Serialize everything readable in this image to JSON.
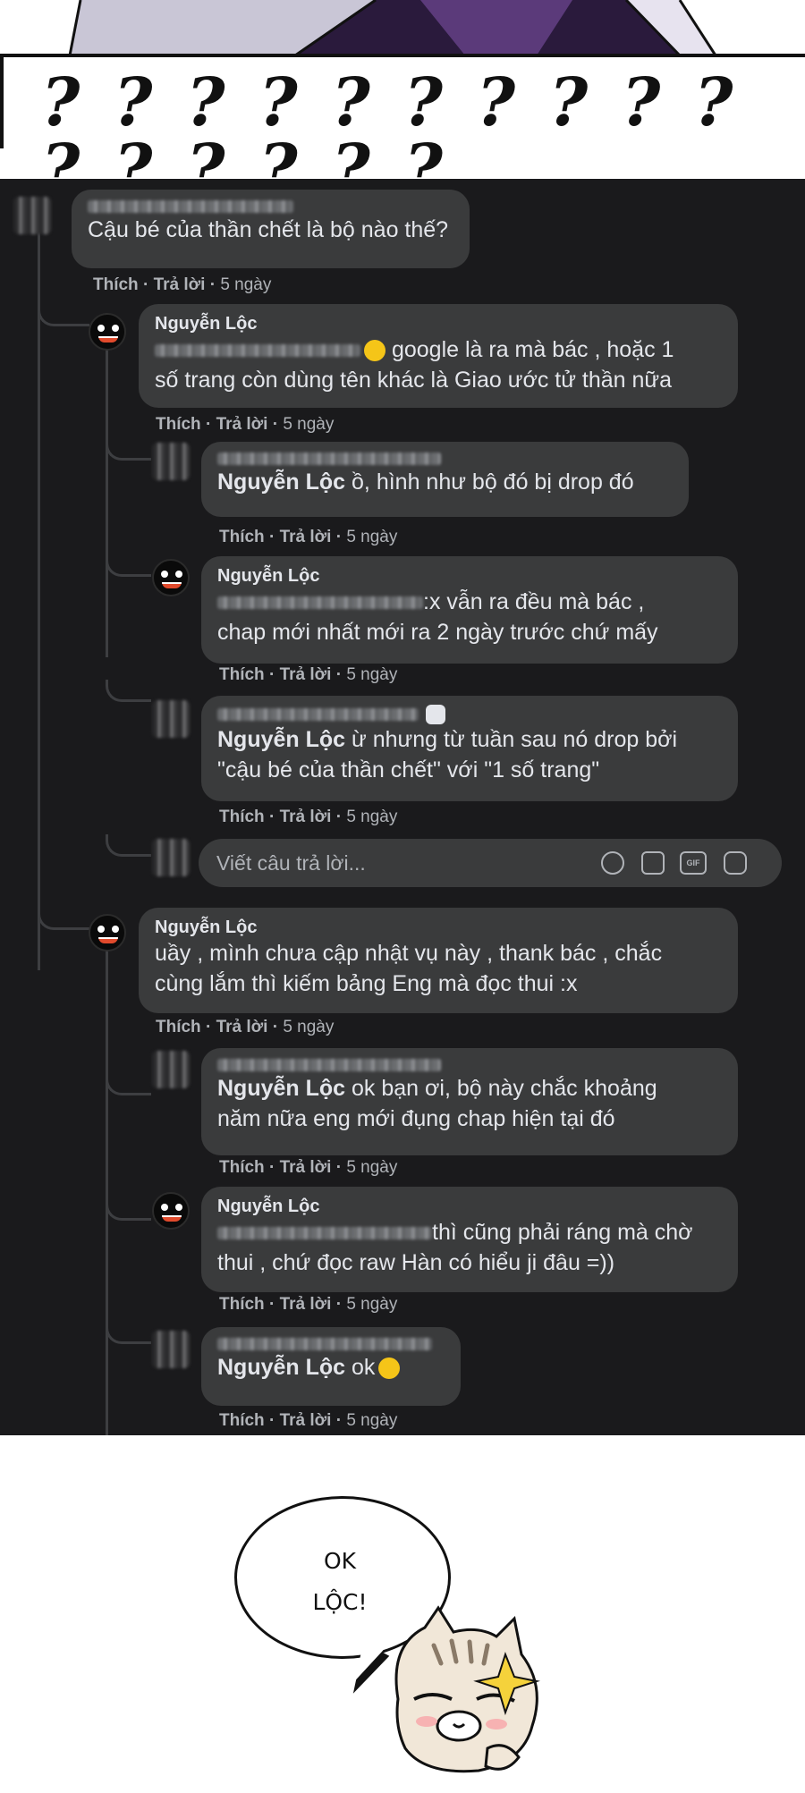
{
  "top_panel": {
    "exclamation": "? ? ? ? ? ? ? ? ? ? ? ? ? ? ? ?"
  },
  "thread": {
    "root": {
      "text": "Cậu bé của thần chết là bộ nào thế?",
      "meta": {
        "like": "Thích",
        "reply": "Trả lời",
        "time": "5 ngày"
      }
    },
    "comments": [
      {
        "author": "Nguyễn Lộc",
        "text_line1": "google là ra mà bác , hoặc 1",
        "text_line2": "số trang còn dùng tên khác là Giao ước tử thần nữa",
        "like": "Thích",
        "reply": "Trả lời",
        "time": "5 ngày"
      },
      {
        "tag": "Nguyễn Lộc",
        "text": " ồ, hình như bộ đó bị drop đó",
        "like": "Thích",
        "reply": "Trả lời",
        "time": "5 ngày"
      },
      {
        "author": "Nguyễn Lộc",
        "text_line1": ":x vẫn ra đều mà bác ,",
        "text_line2": "chap mới nhất mới ra 2 ngày trước chứ mấy",
        "like": "Thích",
        "reply": "Trả lời",
        "time": "5 ngày"
      },
      {
        "tag": "Nguyễn Lộc",
        "text_line1": " ừ nhưng từ tuần sau nó drop bởi",
        "text_line2": "\"cậu bé của thần chết\" với \"1 số trang\"",
        "like": "Thích",
        "reply": "Trả lời",
        "time": "5 ngày"
      },
      {
        "author": "Nguyễn Lộc",
        "text_line1": "uầy , mình chưa cập nhật vụ này , thank bác , chắc",
        "text_line2": "cùng lắm thì kiếm bảng Eng mà đọc thui :x",
        "like": "Thích",
        "reply": "Trả lời",
        "time": "5 ngày"
      },
      {
        "tag": "Nguyễn Lộc",
        "text_line1": " ok bạn ơi, bộ này chắc khoảng",
        "text_line2": "năm nữa eng mới đụng chap hiện tại đó",
        "like": "Thích",
        "reply": "Trả lời",
        "time": "5 ngày"
      },
      {
        "author": "Nguyễn Lộc",
        "text_line1": "thì cũng phải ráng mà chờ",
        "text_line2": "thui , chứ đọc raw Hàn có hiểu ji đâu =))",
        "like": "Thích",
        "reply": "Trả lời",
        "time": "5 ngày"
      },
      {
        "tag": "Nguyễn Lộc",
        "text": " ok",
        "like": "Thích",
        "reply": "Trả lời",
        "time": "5 ngày"
      }
    ],
    "reply_box": {
      "placeholder": "Viết câu trả lời...",
      "gif_label": "GIF"
    }
  },
  "bottom_panel": {
    "speech_line1": "OK",
    "speech_line2": "LỘC!"
  },
  "colors": {
    "background": "#1a1a1c",
    "bubble": "#3a3b3c",
    "text": "#e4e6eb",
    "meta": "#b0b3b8"
  }
}
